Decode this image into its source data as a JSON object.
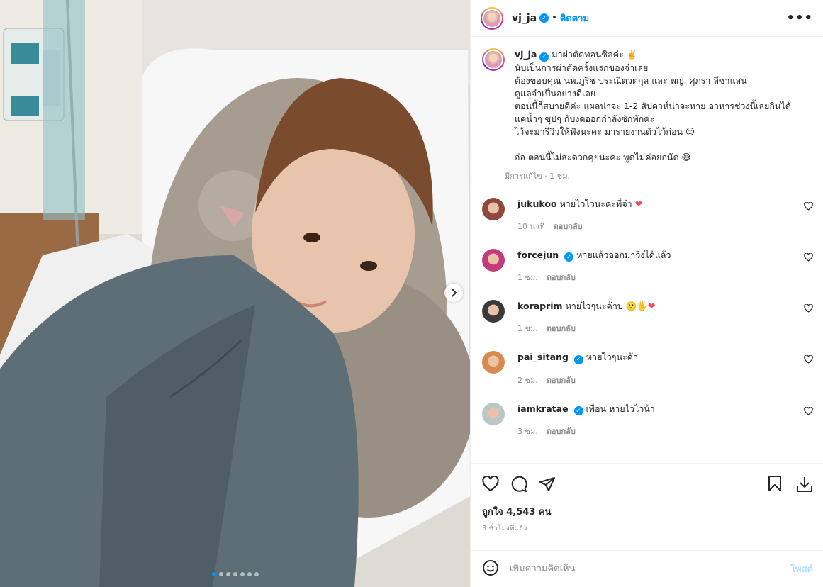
{
  "post": {
    "username": "vj_ja",
    "separator": "•",
    "follow_label": "ติดตาม",
    "more_label": "•••",
    "caption": "มาผ่าตัดทอนซิลค่ะ ✌️\nนับเป็นการผ่าตัดครั้งแรกของจ๋าเลย\nต้องขอบคุณ นพ.ภูริช ประณีตวตกุล และ พญ. ศุภรา ลีซาแสน\nดูแลจ๋าเป็นอย่างดีเลย\nตอนนี้ก็สบายดีค่ะ แผลน่าจะ 1-2 สัปดาห์น่าจะหาย อาหารช่วงนี้เลยกินได้\nแค่น้ำๆ ซุปๆ กับงดออกกำลังซักพักค่ะ\nไว้จะมารีวิวให้ฟังนะคะ มารายงานตัวไว้ก่อน ☺︎\n\nอ่อ ตอนนี้ไม่สะดวกคุยนะคะ พูดไม่ค่อยถนัด 😅",
    "edited": "มีการแก้ไข · 1 ชม.",
    "likes": "ถูกใจ 4,543 คน",
    "timestamp": "3 ชั่วโมงที่แล้ว",
    "comment_placeholder": "เพิ่มความคิดเห็น",
    "post_label": "โพสต์"
  },
  "comments": [
    {
      "user": "jukukoo",
      "verified": false,
      "text": "หายไวไวนะคะพี่จ๋า",
      "emoji": "❤",
      "time": "10 นาที",
      "reply": "ตอบกลับ",
      "avatar_color": "#8b4a3c"
    },
    {
      "user": "forcejun",
      "verified": true,
      "text": "หายแล้วออกมาวิ่งได้แล้ว",
      "emoji": "",
      "time": "1 ชม.",
      "reply": "ตอบกลับ",
      "avatar_color": "#c23b7a"
    },
    {
      "user": "koraprim",
      "verified": false,
      "text": "หายไวๆนะค้าบ",
      "emoji": "🙁🖐❤",
      "time": "1 ชม.",
      "reply": "ตอบกลับ",
      "avatar_color": "#3a3a3a"
    },
    {
      "user": "pai_sitang",
      "verified": true,
      "text": "หายไวๆนะค้า",
      "emoji": "",
      "time": "2 ชม.",
      "reply": "ตอบกลับ",
      "avatar_color": "#d98a4f"
    },
    {
      "user": "iamkratae",
      "verified": true,
      "text": "เพื่อน หายไวไวน้า",
      "emoji": "",
      "time": "3 ชม.",
      "reply": "ตอบกลับ",
      "avatar_color": "#b9c7c9"
    }
  ],
  "carousel": {
    "total": 7,
    "active": 0
  },
  "icons": {
    "like": "heart-icon",
    "comment": "comment-icon",
    "share": "share-icon",
    "save": "bookmark-icon",
    "download": "download-icon",
    "emoji": "smiley-icon",
    "next": "chevron-right-icon",
    "comment_like": "small-heart-icon"
  },
  "colors": {
    "accent": "#0095f6",
    "heart": "#ed4956",
    "muted": "#8e8e8e"
  }
}
